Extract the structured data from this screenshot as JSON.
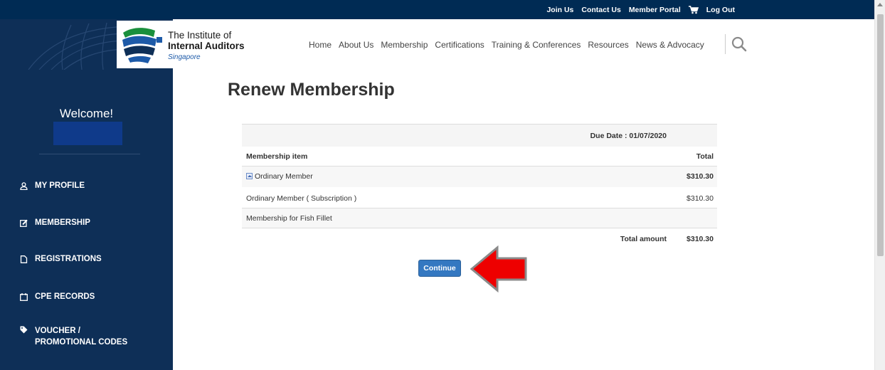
{
  "topbar": {
    "links": [
      "Join Us",
      "Contact Us",
      "Member Portal",
      "Log Out"
    ]
  },
  "logo": {
    "line1": "The Institute of",
    "line2": "Internal Auditors",
    "line3": "Singapore"
  },
  "nav": {
    "items": [
      "Home",
      "About Us",
      "Membership",
      "Certifications",
      "Training & Conferences",
      "Resources",
      "News & Advocacy"
    ]
  },
  "sidebar": {
    "welcome": "Welcome!",
    "items": [
      {
        "label": "MY PROFILE",
        "icon": "user-icon"
      },
      {
        "label": "MEMBERSHIP",
        "icon": "edit-icon"
      },
      {
        "label": "REGISTRATIONS",
        "icon": "document-icon"
      },
      {
        "label": "CPE RECORDS",
        "icon": "calendar-icon"
      },
      {
        "label": "VOUCHER /",
        "label2": "PROMOTIONAL CODES",
        "icon": "tag-icon"
      }
    ]
  },
  "main": {
    "title": "Renew Membership",
    "due_date": "Due Date : 01/07/2020",
    "col_item": "Membership item",
    "col_total": "Total",
    "rows": [
      {
        "item": "Ordinary Member",
        "total": "$310.30"
      },
      {
        "item": "Ordinary Member ( Subscription )",
        "total": "$310.30"
      },
      {
        "item": "Membership for Fish Fillet",
        "total": ""
      }
    ],
    "total_label": "Total amount",
    "total_value": "$310.30",
    "continue": "Continue"
  },
  "colors": {
    "navy": "#0e2f57",
    "topbar": "#002b54",
    "button": "#3478c1",
    "arrow": "#ee0000"
  }
}
